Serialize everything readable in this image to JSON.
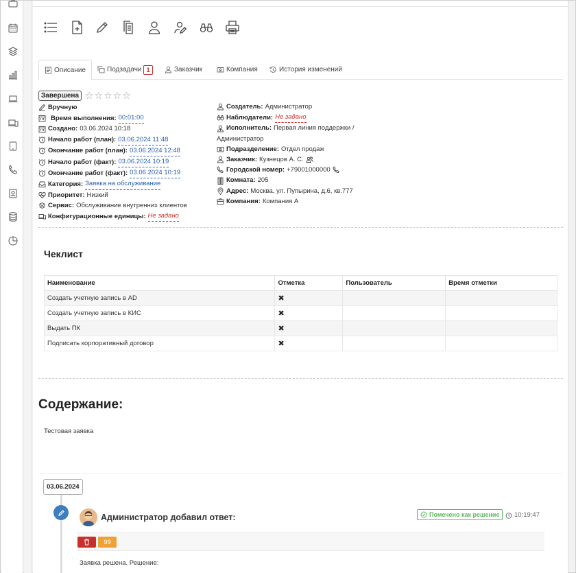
{
  "tabs": [
    {
      "label": "Описание"
    },
    {
      "label": "Подзадачи",
      "badge": "1"
    },
    {
      "label": "Заказчик"
    },
    {
      "label": "Компания"
    },
    {
      "label": "История изменений"
    }
  ],
  "status": {
    "label": "Завершена",
    "stars": "☆☆☆☆☆"
  },
  "left_fields": {
    "mode": "Вручную",
    "exec_time_label": "Время выполнения:",
    "exec_time": "00:01:00",
    "created_label": "Создано:",
    "created": "03.06.2024 10:18",
    "plan_start_label": "Начало работ (план):",
    "plan_start": "03.06.2024 11:48",
    "plan_end_label": "Окончание работ (план):",
    "plan_end": "03.06.2024 12:48",
    "fact_start_label": "Начало работ (факт):",
    "fact_start": "03.06.2024 10:19",
    "fact_end_label": "Окончание работ (факт):",
    "fact_end": "03.06.2024 10:19",
    "category_label": "Категория:",
    "category": "Заявка на обслуживание",
    "priority_label": "Приоритет:",
    "priority": "Низкий",
    "service_label": "Сервис:",
    "service": "Обслуживание внутренних клиентов",
    "ci_label": "Конфигурационные единицы:",
    "ci": "Не задано"
  },
  "right_fields": {
    "creator_label": "Создатель:",
    "creator": "Администратор",
    "observers_label": "Наблюдатели:",
    "observers": "Не задано",
    "executor_label": "Исполнитель:",
    "executor_line1": "Первая линия поддержки /",
    "executor_line2": "Администратор",
    "department_label": "Подразделение:",
    "department": "Отдел продаж",
    "customer_label": "Заказчик:",
    "customer": "Кузнецов А. С.",
    "phone_label": "Городской номер:",
    "phone": "+79001000000",
    "room_label": "Комната:",
    "room": "205",
    "address_label": "Адрес:",
    "address": "Москва, ул. Пупырина, д.6, кв.777",
    "company_label": "Компания:",
    "company": "Компания А"
  },
  "checklist": {
    "title": "Чеклист",
    "headers": [
      "Наименование",
      "Отметка",
      "Пользователь",
      "Время отметки"
    ],
    "rows": [
      {
        "name": "Создать учетную запись в AD",
        "mark": "✖",
        "user": "",
        "time": ""
      },
      {
        "name": "Создать учетную запись в КИС",
        "mark": "✖",
        "user": "",
        "time": ""
      },
      {
        "name": "Выдать ПК",
        "mark": "✖",
        "user": "",
        "time": ""
      },
      {
        "name": "Подписать корпоративный договор",
        "mark": "✖",
        "user": "",
        "time": ""
      }
    ]
  },
  "content": {
    "title": "Содержание:",
    "text": "Тестовая заявка"
  },
  "timeline": {
    "date": "03.06.2024",
    "comment_title": "Администратор добавил ответ:",
    "solution_label": "Помечено как решение",
    "time": "10:19:47",
    "quote_label": "99",
    "body": "Заявка решена. Решение:"
  },
  "colors": {
    "link": "#2a5db0",
    "danger": "#c9302c",
    "warning": "#eea236",
    "success": "#5cb85c",
    "timeline": "#3c7ec0"
  }
}
